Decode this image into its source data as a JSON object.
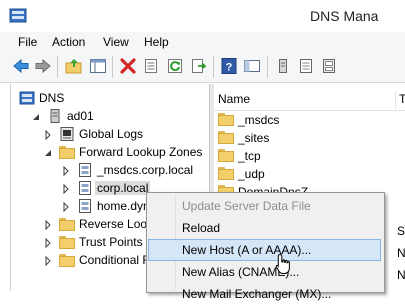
{
  "window": {
    "title": "DNS Mana"
  },
  "menu": [
    "File",
    "Action",
    "View",
    "Help"
  ],
  "toolbar": {
    "buttons": [
      {
        "name": "back-arrow-icon"
      },
      {
        "name": "forward-arrow-icon"
      },
      {
        "name": "folder-up-icon"
      },
      {
        "name": "show-hide-tree-icon"
      },
      {
        "name": "delete-icon"
      },
      {
        "name": "properties-icon"
      },
      {
        "name": "refresh-icon"
      },
      {
        "name": "export-list-icon"
      },
      {
        "name": "help-icon"
      },
      {
        "name": "console-tree-icon"
      },
      {
        "name": "dns-server-icon"
      },
      {
        "name": "zone-records-icon"
      },
      {
        "name": "domain-icon"
      }
    ]
  },
  "tree": {
    "root": "DNS",
    "server": "ad01",
    "items": [
      {
        "label": "Global Logs",
        "kind": "logs",
        "level": 2,
        "twisty": "collapsed"
      },
      {
        "label": "Forward Lookup Zones",
        "kind": "folder",
        "level": 2,
        "twisty": "expanded"
      },
      {
        "label": "_msdcs.corp.local",
        "kind": "zone",
        "level": 3,
        "twisty": "collapsed"
      },
      {
        "label": "corp.local",
        "kind": "zone",
        "level": 3,
        "twisty": "collapsed",
        "selected": true
      },
      {
        "label": "home.dyn",
        "kind": "zone",
        "level": 3,
        "twisty": "collapsed"
      },
      {
        "label": "Reverse Look",
        "kind": "folder",
        "level": 2,
        "twisty": "collapsed"
      },
      {
        "label": "Trust Points",
        "kind": "folder",
        "level": 2,
        "twisty": "collapsed"
      },
      {
        "label": "Conditional F",
        "kind": "folder",
        "level": 2,
        "twisty": "collapsed"
      }
    ]
  },
  "list": {
    "columns": [
      "Name",
      "T"
    ],
    "rows": [
      "_msdcs",
      "_sites",
      "_tcp",
      "_udp",
      "DomainDnsZ"
    ]
  },
  "context_menu": {
    "items": [
      {
        "label": "Update Server Data File",
        "state": "disabled"
      },
      {
        "label": "Reload",
        "state": "normal"
      },
      {
        "label": "New Host (A or AAAA)...",
        "state": "hover"
      },
      {
        "label": "New Alias (CNAME)...",
        "state": "normal"
      },
      {
        "label": "New Mail Exchanger (MX)...",
        "state": "normal"
      }
    ]
  },
  "right_edge_letters": [
    "S",
    "N",
    "N"
  ],
  "colors": {
    "folder": "#f2cf6b",
    "hover": "#d5e6f8",
    "selection": "#dcdcdc"
  }
}
